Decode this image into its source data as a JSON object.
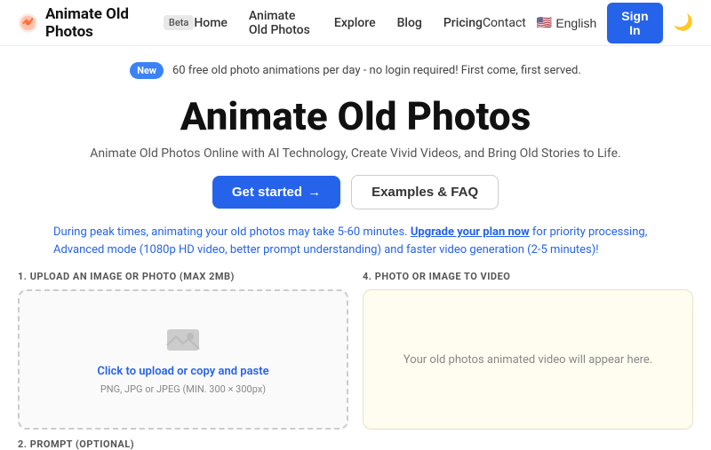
{
  "header": {
    "logo_text": "Animate Old Photos",
    "beta_label": "Beta",
    "nav": [
      {
        "label": "Home",
        "href": "#"
      },
      {
        "label": "Animate Old Photos",
        "href": "#"
      },
      {
        "label": "Explore",
        "href": "#"
      },
      {
        "label": "Blog",
        "href": "#"
      },
      {
        "label": "Pricing",
        "href": "#"
      }
    ],
    "contact_label": "Contact",
    "language_label": "English",
    "sign_in_label": "Sign In",
    "dark_mode_icon": "🌙"
  },
  "banner": {
    "new_label": "New",
    "text": "60 free old photo animations per day - no login required! First come, first served."
  },
  "hero": {
    "title": "Animate Old Photos",
    "subtitle": "Animate Old Photos Online with AI Technology, Create Vivid Videos, and Bring Old Stories to Life.",
    "get_started_label": "Get started",
    "examples_label": "Examples & FAQ"
  },
  "warning": {
    "text_prefix": "During peak times, animating your old photos may take 5-60 minutes.",
    "upgrade_label": "Upgrade your plan now",
    "text_suffix": "for priority processing, Advanced mode (1080p HD video, better prompt understanding) and faster video generation (2-5 minutes)!"
  },
  "upload_section": {
    "label": "1. UPLOAD AN IMAGE OR PHOTO (MAX 2MB)",
    "click_text": "Click to upload",
    "or_text": "or copy and paste",
    "hint": "PNG, JPG or JPEG (MIN. 300 × 300px)"
  },
  "video_section": {
    "label": "4. PHOTO OR IMAGE TO VIDEO",
    "placeholder": "Your old photos animated video will appear here."
  },
  "prompt_section": {
    "label": "2. PROMPT (OPTIONAL)"
  }
}
